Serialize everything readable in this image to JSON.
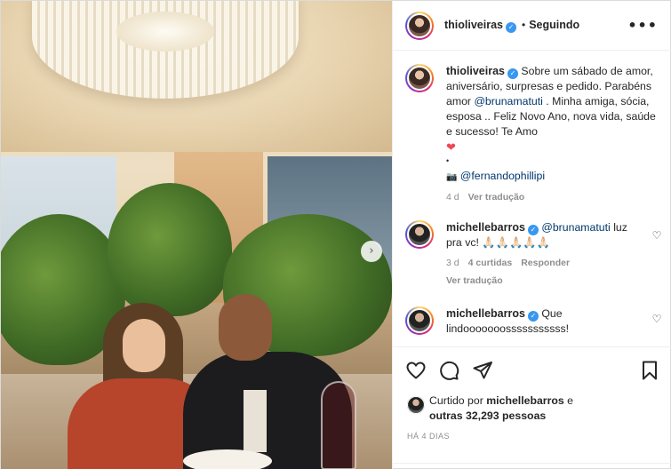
{
  "post": {
    "author": "thioliveiras",
    "separator": "•",
    "follow_status": "Seguindo",
    "more_label": "•••",
    "caption": {
      "username": "thioliveiras",
      "text_1": "Sobre um sábado de amor, aniversário, surpresas e pedido. Parabéns amor ",
      "mention": "@brunamatuti",
      "text_2": " . Minha amiga, sócia, esposa .. Feliz Novo Ano, nova vida, saúde e sucesso! Te Amo",
      "heart": "❤",
      "bullet": "•",
      "credit_icon": "📷",
      "credit": "@fernandophillipi",
      "age": "4 d",
      "translate": "Ver tradução"
    },
    "comments": [
      {
        "username": "michellebarros",
        "mention": "@brunamatuti",
        "text": " luz pra vc! 🙏🏻🙏🏻🙏🏻🙏🏻🙏🏻",
        "age": "3 d",
        "likes": "4 curtidas",
        "reply": "Responder",
        "translate": "Ver tradução"
      },
      {
        "username": "michellebarros",
        "text": "Que lindooooooosssssssssss!"
      }
    ],
    "liked_by_prefix": "Curtido por ",
    "liked_by_user": "michellebarros",
    "liked_by_mid": " e",
    "liked_by_count": "outras 32,293 pessoas",
    "time_ago": "HÁ 4 DIAS"
  },
  "icons": {
    "next": "chevron-right-icon",
    "like": "heart-icon",
    "comment": "comment-icon",
    "share": "share-icon",
    "save": "bookmark-icon",
    "verified": "verified-badge-icon"
  },
  "colors": {
    "verified": "#3897f0",
    "mention": "#00376b",
    "meta": "#8e8e8e",
    "heart": "#ed4956"
  }
}
